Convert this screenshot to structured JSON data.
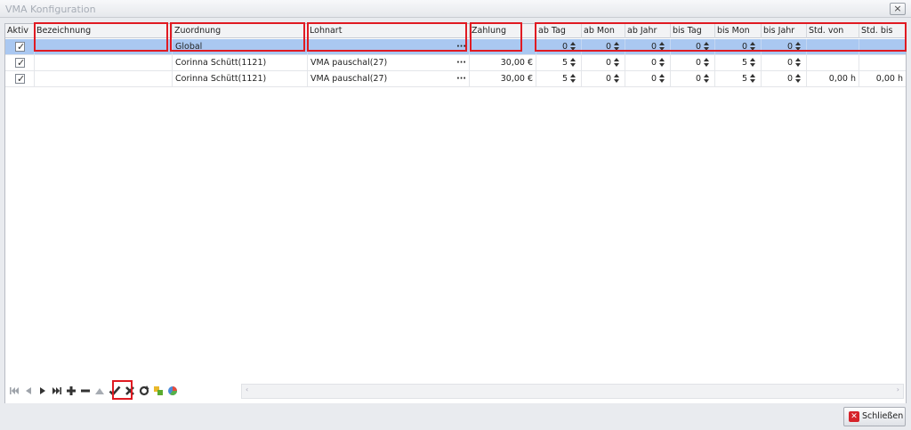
{
  "window": {
    "title": "VMA Konfiguration",
    "close_glyph": "×"
  },
  "columns": [
    "Aktiv",
    "Bezeichnung",
    "Zuordnung",
    "Lohnart",
    "Zahlung",
    "ab Tag",
    "ab Mon",
    "ab Jahr",
    "bis Tag",
    "bis Mon",
    "bis Jahr",
    "Std. von",
    "Std. bis"
  ],
  "rows": [
    {
      "zuordnung": "Global",
      "lohnart": "",
      "zahlung": "",
      "ab_tag": "0",
      "ab_mon": "0",
      "ab_jahr": "0",
      "bis_tag": "0",
      "bis_mon": "0",
      "bis_jahr": "0",
      "std_von": "",
      "std_bis": ""
    },
    {
      "zuordnung": "Corinna Schütt(1121)",
      "lohnart": "VMA pauschal(27)",
      "zahlung": "30,00 €",
      "ab_tag": "5",
      "ab_mon": "0",
      "ab_jahr": "0",
      "bis_tag": "0",
      "bis_mon": "5",
      "bis_jahr": "0",
      "std_von": "",
      "std_bis": ""
    },
    {
      "zuordnung": "Corinna Schütt(1121)",
      "lohnart": "VMA pauschal(27)",
      "zahlung": "30,00 €",
      "ab_tag": "5",
      "ab_mon": "0",
      "ab_jahr": "0",
      "bis_tag": "0",
      "bis_mon": "5",
      "bis_jahr": "0",
      "std_von": "0,00 h",
      "std_bis": "0,00 h"
    }
  ],
  "footer": {
    "close_label": "Schließen"
  },
  "icons": [
    "first-icon",
    "prev-icon",
    "next-icon",
    "last-icon",
    "add-icon",
    "remove-icon",
    "edit-icon",
    "save-icon",
    "cancel-icon",
    "refresh-icon",
    "copy-icon",
    "filter-icon"
  ],
  "colors": {
    "selected_row": "#aac8f1",
    "highlight": "#e01a22"
  }
}
